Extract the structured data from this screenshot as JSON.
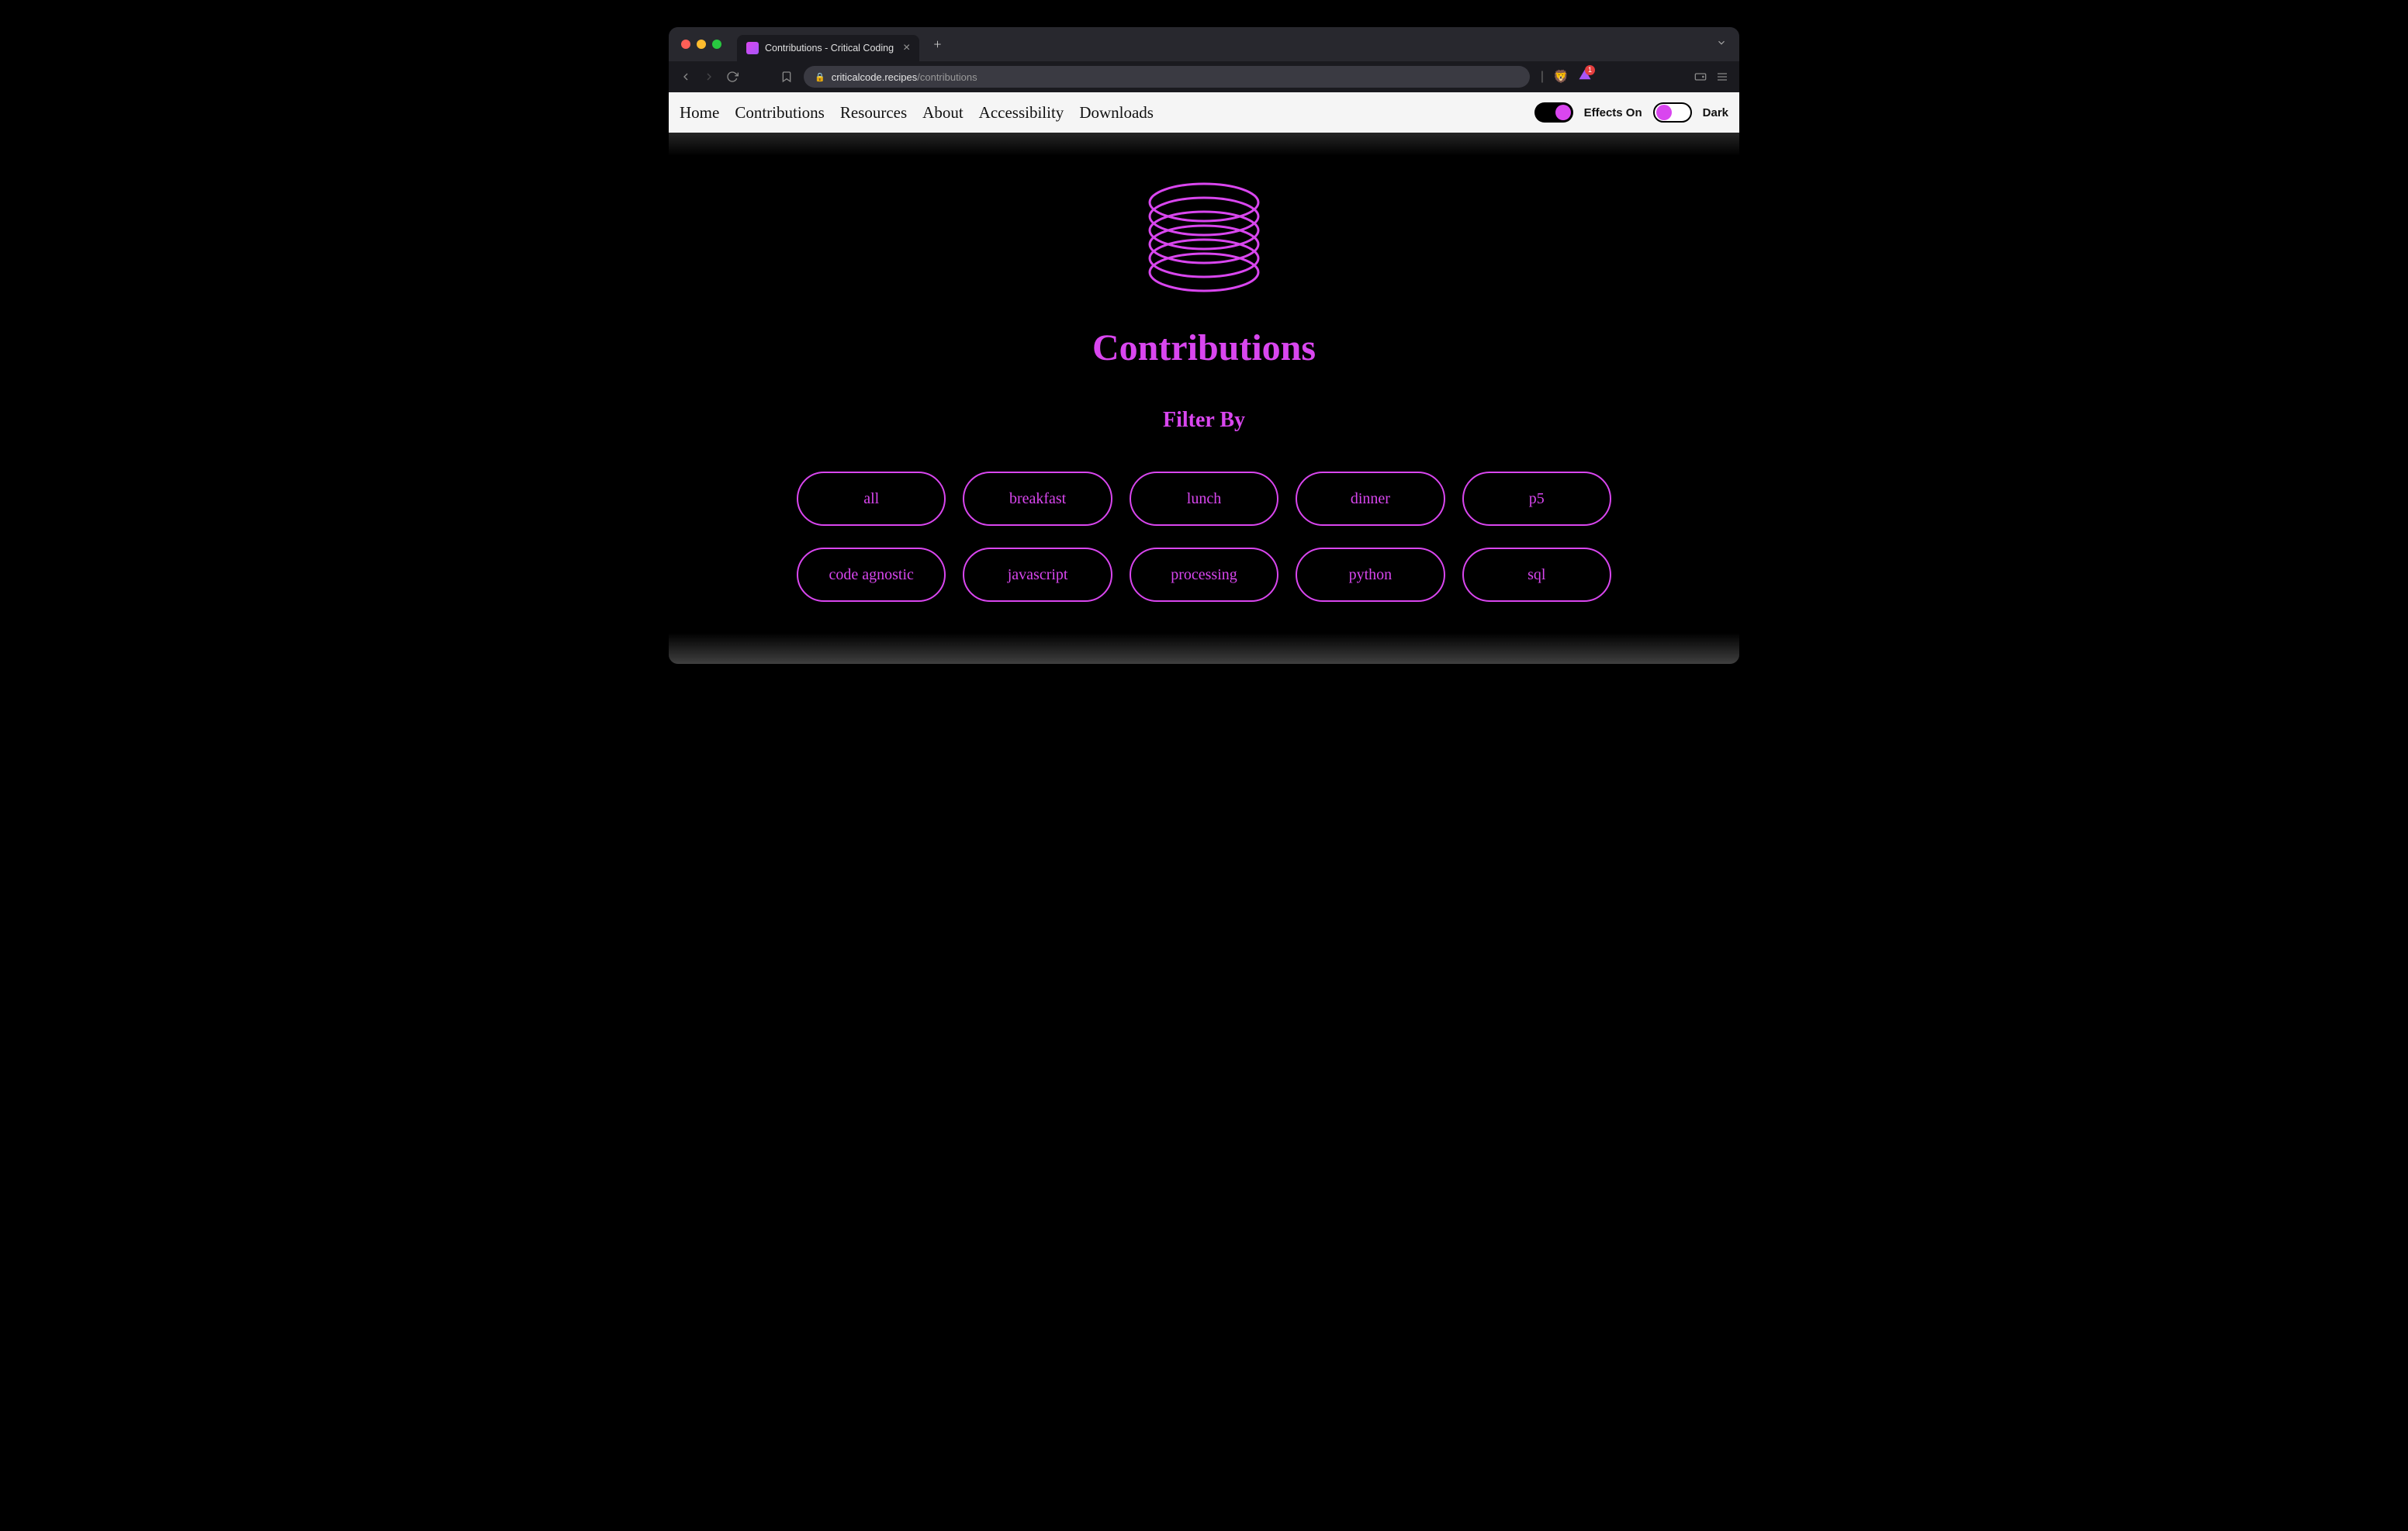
{
  "browser": {
    "tab_title": "Contributions - Critical Coding",
    "url_domain": "criticalcode.recipes",
    "url_path": "/contributions",
    "badge_count": "1"
  },
  "nav": {
    "items": [
      "Home",
      "Contributions",
      "Resources",
      "About",
      "Accessibility",
      "Downloads"
    ],
    "effects_label": "Effects On",
    "dark_label": "Dark"
  },
  "page": {
    "title": "Contributions",
    "filter_label": "Filter By",
    "filters": [
      "all",
      "breakfast",
      "lunch",
      "dinner",
      "p5",
      "code agnostic",
      "javascript",
      "processing",
      "python",
      "sql"
    ]
  },
  "colors": {
    "accent": "#d946ef"
  }
}
